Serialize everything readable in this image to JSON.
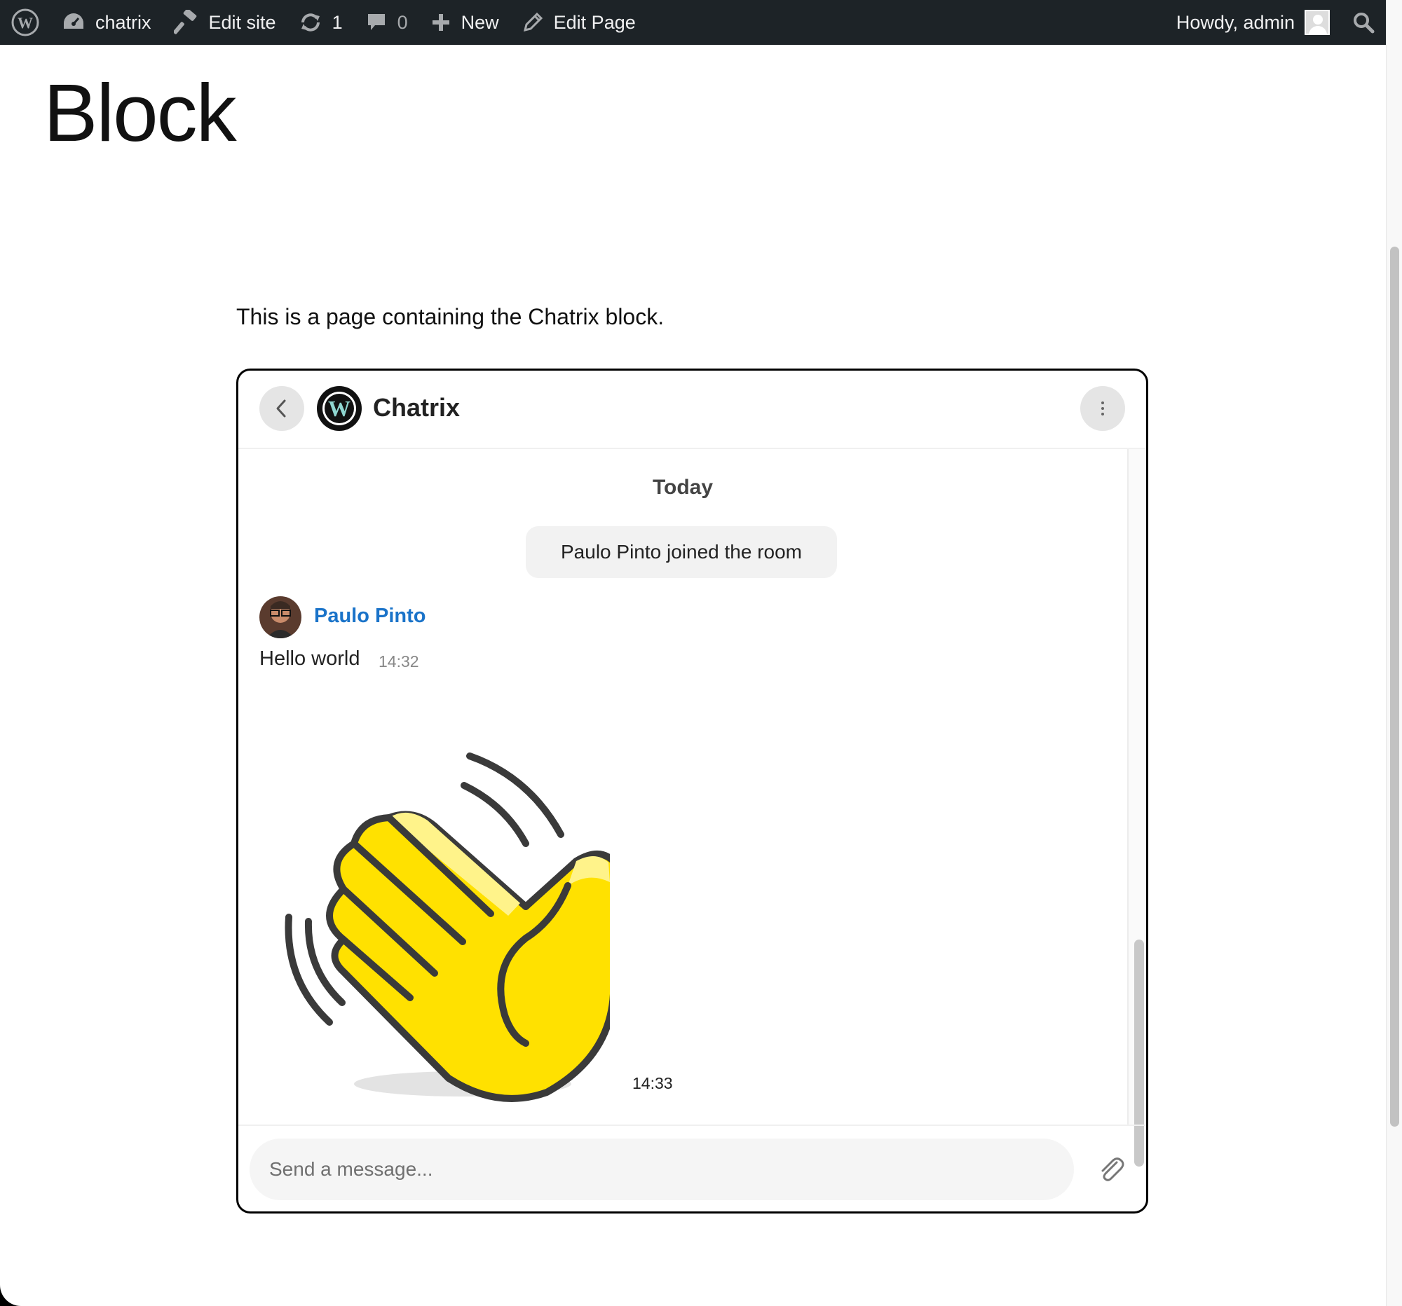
{
  "adminbar": {
    "site_name": "chatrix",
    "edit_site": "Edit site",
    "updates_count": "1",
    "comments_count": "0",
    "new_label": "New",
    "edit_page": "Edit Page",
    "howdy": "Howdy, admin",
    "icons": [
      "wordpress-logo-icon",
      "dashboard-icon",
      "hammer-icon",
      "refresh-icon",
      "comment-icon",
      "plus-icon",
      "pencil-icon",
      "avatar",
      "search-icon"
    ]
  },
  "page": {
    "title": "Block",
    "intro": "This is a page containing the Chatrix block."
  },
  "chatrix": {
    "room_name": "Chatrix",
    "date_separator": "Today",
    "join_event": "Paulo Pinto joined the room",
    "message": {
      "sender": "Paulo Pinto",
      "text": "Hello world",
      "time": "14:32"
    },
    "sticker": {
      "icon": "waving-hand-sticker",
      "time": "14:33"
    },
    "composer": {
      "placeholder": "Send a message...",
      "value": ""
    },
    "colors": {
      "sender_name": "#1a73c9",
      "sticker_yellow": "#ffe100",
      "border": "#000000"
    }
  }
}
